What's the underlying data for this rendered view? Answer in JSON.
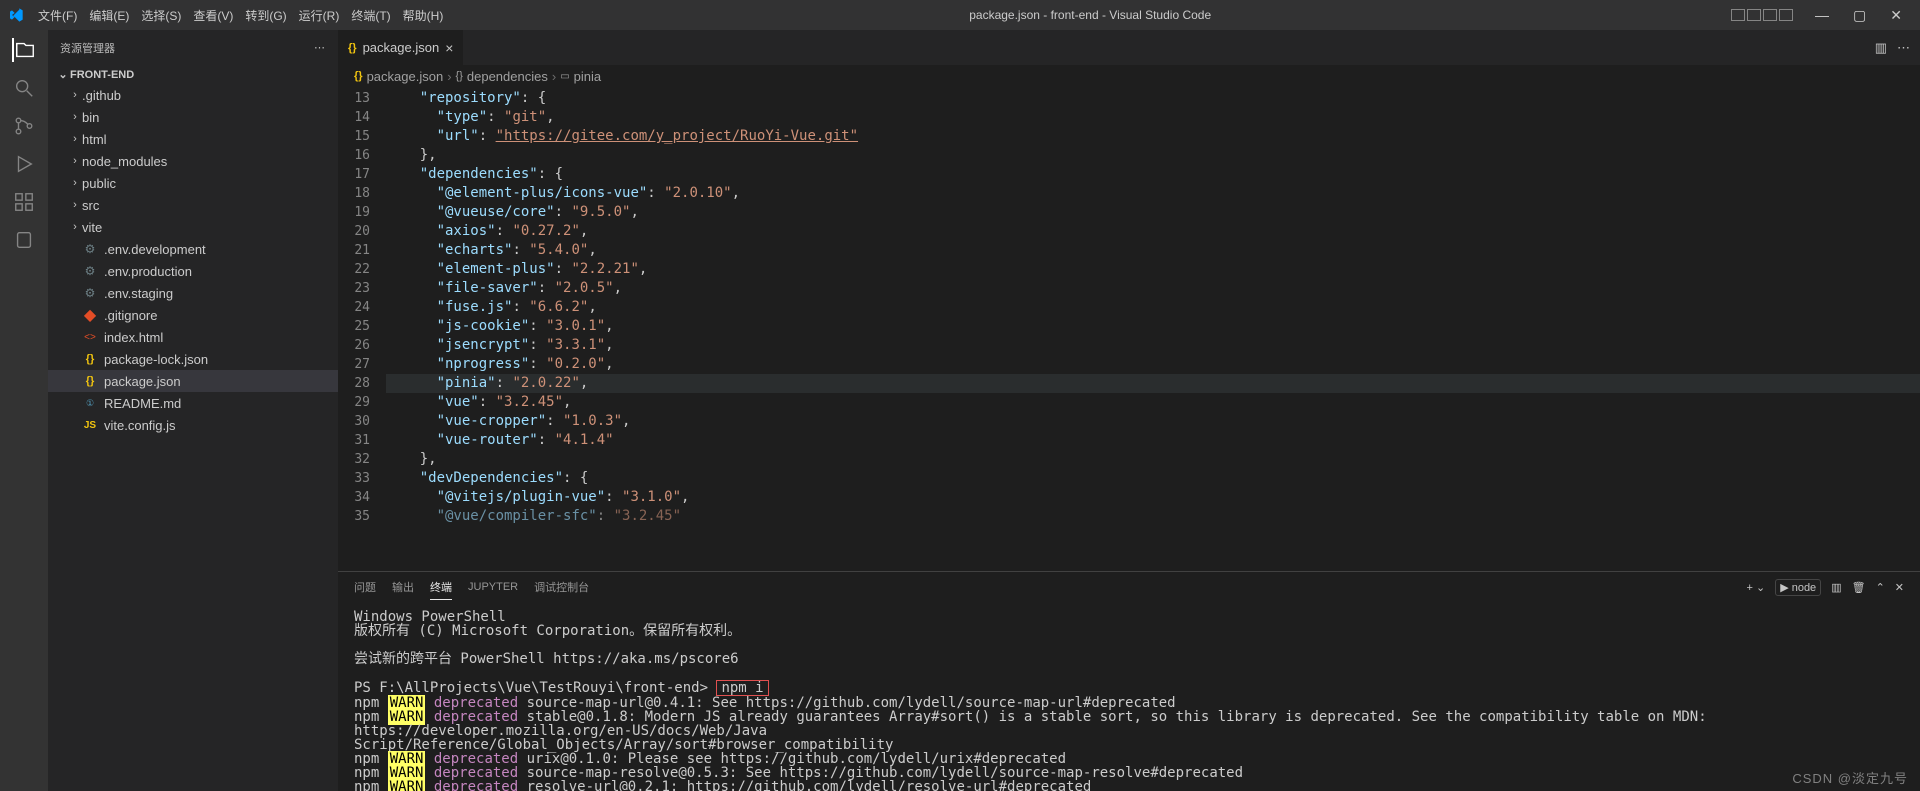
{
  "menu": [
    "文件(F)",
    "编辑(E)",
    "选择(S)",
    "查看(V)",
    "转到(G)",
    "运行(R)",
    "终端(T)",
    "帮助(H)"
  ],
  "windowTitle": "package.json - front-end - Visual Studio Code",
  "sidebar": {
    "title": "资源管理器",
    "root": "FRONT-END",
    "items": [
      {
        "type": "folder",
        "name": ".github"
      },
      {
        "type": "folder",
        "name": "bin"
      },
      {
        "type": "folder",
        "name": "html"
      },
      {
        "type": "folder",
        "name": "node_modules"
      },
      {
        "type": "folder",
        "name": "public"
      },
      {
        "type": "folder",
        "name": "src"
      },
      {
        "type": "folder",
        "name": "vite"
      },
      {
        "type": "file",
        "name": ".env.development",
        "icon": "gear"
      },
      {
        "type": "file",
        "name": ".env.production",
        "icon": "gear"
      },
      {
        "type": "file",
        "name": ".env.staging",
        "icon": "gear"
      },
      {
        "type": "file",
        "name": ".gitignore",
        "icon": "git"
      },
      {
        "type": "file",
        "name": "index.html",
        "icon": "html"
      },
      {
        "type": "file",
        "name": "package-lock.json",
        "icon": "json"
      },
      {
        "type": "file",
        "name": "package.json",
        "icon": "json",
        "selected": true
      },
      {
        "type": "file",
        "name": "README.md",
        "icon": "md"
      },
      {
        "type": "file",
        "name": "vite.config.js",
        "icon": "js"
      }
    ]
  },
  "tab": {
    "label": "package.json"
  },
  "breadcrumb": [
    "package.json",
    "dependencies",
    "pinia"
  ],
  "bcIcons": [
    "{}",
    "{}",
    "▭"
  ],
  "lineNumbers": [
    13,
    14,
    15,
    16,
    17,
    18,
    19,
    20,
    21,
    22,
    23,
    24,
    25,
    26,
    27,
    28,
    29,
    30,
    31,
    32,
    33,
    34,
    35
  ],
  "highlightLine": 28,
  "code": {
    "repoKey": "repository",
    "type": {
      "k": "type",
      "v": "git"
    },
    "url": {
      "k": "url",
      "v": "https://gitee.com/y_project/RuoYi-Vue.git"
    },
    "dependencies": "dependencies",
    "deps": [
      {
        "k": "@element-plus/icons-vue",
        "v": "2.0.10"
      },
      {
        "k": "@vueuse/core",
        "v": "9.5.0"
      },
      {
        "k": "axios",
        "v": "0.27.2"
      },
      {
        "k": "echarts",
        "v": "5.4.0"
      },
      {
        "k": "element-plus",
        "v": "2.2.21"
      },
      {
        "k": "file-saver",
        "v": "2.0.5"
      },
      {
        "k": "fuse.js",
        "v": "6.6.2"
      },
      {
        "k": "js-cookie",
        "v": "3.0.1"
      },
      {
        "k": "jsencrypt",
        "v": "3.3.1"
      },
      {
        "k": "nprogress",
        "v": "0.2.0"
      },
      {
        "k": "pinia",
        "v": "2.0.22"
      },
      {
        "k": "vue",
        "v": "3.2.45"
      },
      {
        "k": "vue-cropper",
        "v": "1.0.3"
      },
      {
        "k": "vue-router",
        "v": "4.1.4"
      }
    ],
    "devDependencies": "devDependencies",
    "devDeps": [
      {
        "k": "@vitejs/plugin-vue",
        "v": "3.1.0"
      }
    ]
  },
  "panel": {
    "tabs": [
      "问题",
      "输出",
      "终端",
      "JUPYTER",
      "调试控制台"
    ],
    "activeTab": 2,
    "shellLabel": "node",
    "lines": {
      "psTitle": "Windows PowerShell",
      "copyright": "版权所有 (C) Microsoft Corporation。保留所有权利。",
      "tryNew": "尝试新的跨平台 PowerShell https://aka.ms/pscore6",
      "prompt": "PS F:\\AllProjects\\Vue\\TestRouyi\\front-end>",
      "cmd": "npm i",
      "warns": [
        {
          "pkg": "source-map-url@0.4.1",
          "msg": "See https://github.com/lydell/source-map-url#deprecated"
        },
        {
          "pkg": "stable@0.1.8",
          "msg": "Modern JS already guarantees Array#sort() is a stable sort, so this library is deprecated. See the compatibility table on MDN: https://developer.mozilla.org/en-US/docs/Web/JavaScript/Reference/Global_Objects/Array/sort#browser_compatibility"
        },
        {
          "pkg": "urix@0.1.0",
          "msg": "Please see https://github.com/lydell/urix#deprecated"
        },
        {
          "pkg": "source-map-resolve@0.5.3",
          "msg": "See https://github.com/lydell/source-map-resolve#deprecated"
        },
        {
          "pkg": "resolve-url@0.2.1",
          "msg": "https://github.com/lydell/resolve-url#deprecated",
          "underline": true
        }
      ]
    }
  },
  "watermark": "CSDN @淡定九号"
}
